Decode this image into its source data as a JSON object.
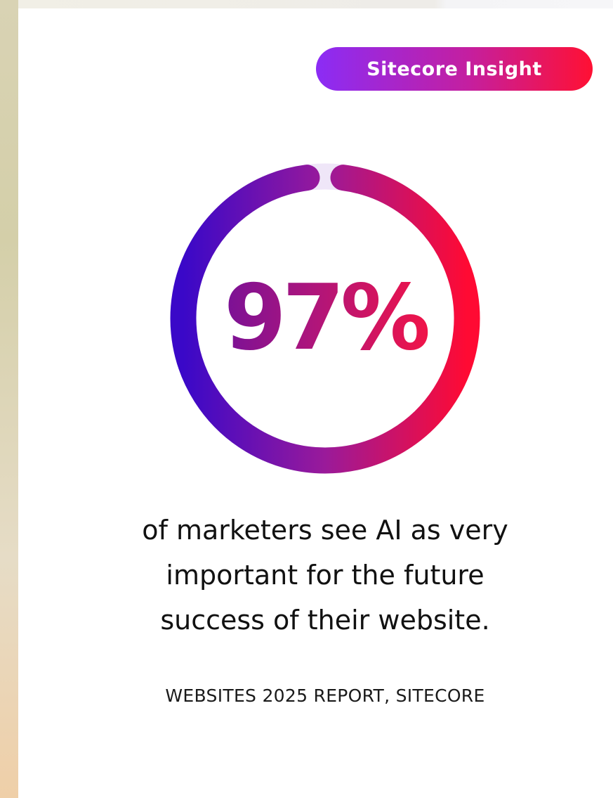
{
  "badge": {
    "label": "Sitecore Insight"
  },
  "stat": {
    "value_text": "97%",
    "value": 0.97
  },
  "headline": "of marketers see AI as very\nimportant for the future\nsuccess of their website.",
  "source": "WEBSITES 2025 REPORT, SITECORE",
  "colors": {
    "gradient_start": "#3a08c8",
    "gradient_mid": "#9a1a9a",
    "gradient_end": "#ff0a33",
    "ring_track": "#efe6f8",
    "badge_start": "#8b2cf5",
    "badge_end": "#ff1033"
  }
}
